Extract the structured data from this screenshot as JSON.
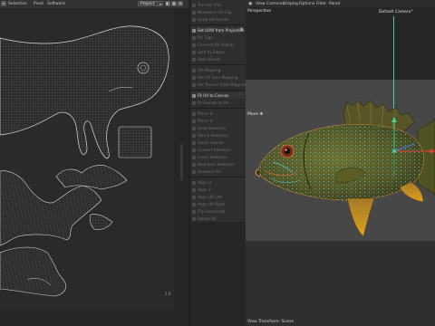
{
  "uv_editor": {
    "menu": [
      "Selection",
      "Pivot",
      "Software"
    ],
    "mode_select": "Project",
    "zoom_value": "1.0"
  },
  "command_panel": {
    "groups": [
      {
        "items": [
          "Transfer UVs",
          "Normalize UV Clip",
          "Scale UV Islands"
        ]
      },
      {
        "items": [
          {
            "label": "Set UVW from Projection",
            "active": true,
            "gear": true
          },
          "UV Tags",
          "Connect UV Islands",
          "Split by Edges",
          "Pack Islands"
        ]
      },
      {
        "items": [
          "UV Mapping",
          "Set UV from Mapping",
          "Set Texture from Mapping"
        ]
      },
      {
        "items": [
          {
            "label": "Fit UV to Canvas",
            "active": true,
            "gear": false
          },
          "Fit Canvas to UV"
        ]
      },
      {
        "items": [
          "Mirror U",
          "Mirror V",
          "Grow Selection",
          "Shrink Selection",
          "Select Islands",
          "Convert Selection",
          "Invert Selection",
          "Boundary Selection",
          "Deselect All"
        ]
      },
      {
        "items": [
          "Align U",
          "Align V",
          "Align UV Left",
          "Align UV Right",
          "Flip Horizontal",
          "Rotate 90",
          "Randomize"
        ]
      }
    ]
  },
  "viewport": {
    "menu": [
      "View",
      "Cameras",
      "Display",
      "Options",
      "Filter",
      "Panel"
    ],
    "projection_label": "Perspective",
    "camera_label": "Default Camera",
    "camera_suffix": "°",
    "move_label": "Move",
    "footer_label": "View Transform: Scene"
  },
  "colors": {
    "axis_y": "#3fd49a",
    "axis_x": "#e04040",
    "axis_z": "#4a7bff",
    "fish_body": "#4d5322",
    "fish_fin": "#c98b1a"
  }
}
